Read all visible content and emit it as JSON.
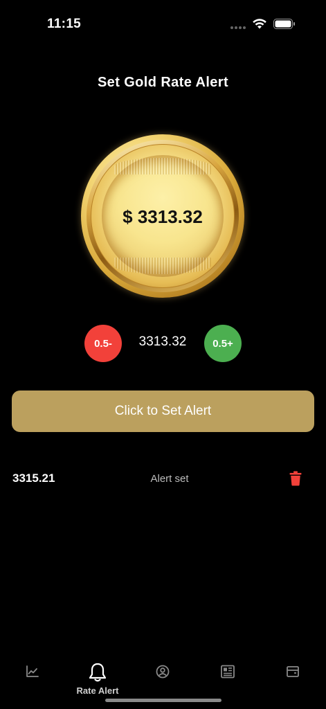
{
  "status_bar": {
    "time": "11:15"
  },
  "page": {
    "title": "Set Gold Rate Alert"
  },
  "coin": {
    "price_label": "$ 3313.32"
  },
  "stepper": {
    "decrease_label": "0.5-",
    "value": "3313.32",
    "increase_label": "0.5+"
  },
  "set_alert_button": {
    "label": "Click to Set Alert"
  },
  "alerts": [
    {
      "value": "3315.21",
      "status": "Alert set"
    }
  ],
  "bottom_nav": {
    "items": [
      {
        "icon": "chart-icon",
        "label": ""
      },
      {
        "icon": "bell-icon",
        "label": "Rate Alert",
        "active": true
      },
      {
        "icon": "user-circle-icon",
        "label": ""
      },
      {
        "icon": "newspaper-icon",
        "label": ""
      },
      {
        "icon": "wallet-icon",
        "label": ""
      }
    ]
  },
  "colors": {
    "background": "#000000",
    "button_gold": "#bba05e",
    "decrease_red": "#f2413a",
    "increase_green": "#4caf50",
    "trash_red": "#f2413a"
  }
}
